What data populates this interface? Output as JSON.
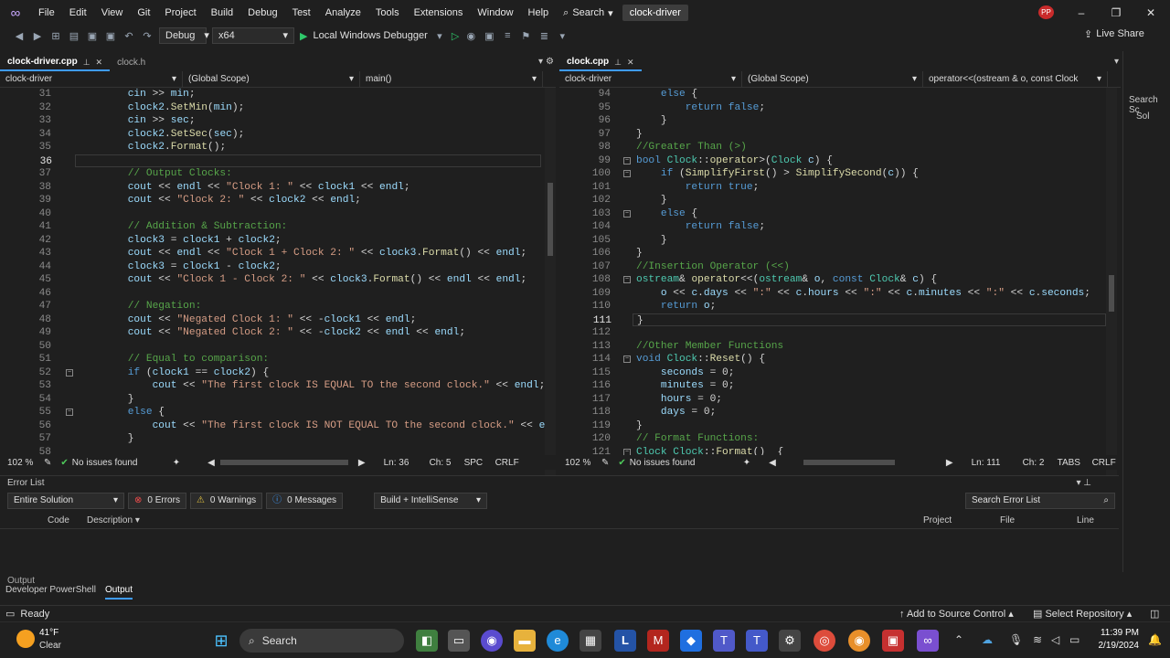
{
  "menu": {
    "items": [
      "File",
      "Edit",
      "View",
      "Git",
      "Project",
      "Build",
      "Debug",
      "Test",
      "Analyze",
      "Tools",
      "Extensions",
      "Window",
      "Help"
    ],
    "search_label": "Search",
    "project_name": "clock-driver",
    "avatar": "PP"
  },
  "toolbar": {
    "config": "Debug",
    "platform": "x64",
    "debugger": "Local Windows Debugger",
    "live_share": "Live Share"
  },
  "left_pane": {
    "tabs": [
      {
        "label": "clock-driver.cpp",
        "active": true
      },
      {
        "label": "clock.h",
        "active": false
      }
    ],
    "nav": [
      "clock-driver",
      "(Global Scope)",
      "main()"
    ],
    "lines": [
      {
        "n": "31",
        "t": "        cin >> min;"
      },
      {
        "n": "32",
        "t": "        clock2.SetMin(min);"
      },
      {
        "n": "33",
        "t": "        cin >> sec;"
      },
      {
        "n": "34",
        "t": "        clock2.SetSec(sec);"
      },
      {
        "n": "35",
        "t": "        clock2.Format();"
      },
      {
        "n": "36",
        "t": ""
      },
      {
        "n": "37",
        "t": "        // Output Clocks:"
      },
      {
        "n": "38",
        "t": "        cout << endl << \"Clock 1: \" << clock1 << endl;"
      },
      {
        "n": "39",
        "t": "        cout << \"Clock 2: \" << clock2 << endl;"
      },
      {
        "n": "40",
        "t": ""
      },
      {
        "n": "41",
        "t": "        // Addition & Subtraction:"
      },
      {
        "n": "42",
        "t": "        clock3 = clock1 + clock2;"
      },
      {
        "n": "43",
        "t": "        cout << endl << \"Clock 1 + Clock 2: \" << clock3.Format() << endl;"
      },
      {
        "n": "44",
        "t": "        clock3 = clock1 - clock2;"
      },
      {
        "n": "45",
        "t": "        cout << \"Clock 1 - Clock 2: \" << clock3.Format() << endl << endl;"
      },
      {
        "n": "46",
        "t": ""
      },
      {
        "n": "47",
        "t": "        // Negation:"
      },
      {
        "n": "48",
        "t": "        cout << \"Negated Clock 1: \" << -clock1 << endl;"
      },
      {
        "n": "49",
        "t": "        cout << \"Negated Clock 2: \" << -clock2 << endl << endl;"
      },
      {
        "n": "50",
        "t": ""
      },
      {
        "n": "51",
        "t": "        // Equal to comparison:"
      },
      {
        "n": "52",
        "t": "        if (clock1 == clock2) {"
      },
      {
        "n": "53",
        "t": "            cout << \"The first clock IS EQUAL TO the second clock.\" << endl;"
      },
      {
        "n": "54",
        "t": "        }"
      },
      {
        "n": "55",
        "t": "        else {"
      },
      {
        "n": "56",
        "t": "            cout << \"The first clock IS NOT EQUAL TO the second clock.\" << endl;"
      },
      {
        "n": "57",
        "t": "        }"
      },
      {
        "n": "58",
        "t": ""
      }
    ],
    "current_line": "36",
    "status": {
      "zoom": "102 %",
      "issues": "No issues found",
      "ln": "Ln: 36",
      "ch": "Ch: 5",
      "ws": "SPC",
      "eol": "CRLF"
    }
  },
  "right_pane": {
    "tabs": [
      {
        "label": "clock.cpp",
        "active": true
      }
    ],
    "nav": [
      "clock-driver",
      "(Global Scope)",
      "operator<<(ostream & o, const Clock"
    ],
    "lines": [
      {
        "n": "94",
        "t": "    else {"
      },
      {
        "n": "95",
        "t": "        return false;"
      },
      {
        "n": "96",
        "t": "    }"
      },
      {
        "n": "97",
        "t": "}"
      },
      {
        "n": "98",
        "t": "//Greater Than (>)"
      },
      {
        "n": "99",
        "t": "bool Clock::operator>(Clock c) {"
      },
      {
        "n": "100",
        "t": "    if (SimplifyFirst() > SimplifySecond(c)) {"
      },
      {
        "n": "101",
        "t": "        return true;"
      },
      {
        "n": "102",
        "t": "    }"
      },
      {
        "n": "103",
        "t": "    else {"
      },
      {
        "n": "104",
        "t": "        return false;"
      },
      {
        "n": "105",
        "t": "    }"
      },
      {
        "n": "106",
        "t": "}"
      },
      {
        "n": "107",
        "t": "//Insertion Operator (<<)"
      },
      {
        "n": "108",
        "t": "ostream& operator<<(ostream& o, const Clock& c) {"
      },
      {
        "n": "109",
        "t": "    o << c.days << \":\" << c.hours << \":\" << c.minutes << \":\" << c.seconds;"
      },
      {
        "n": "110",
        "t": "    return o;"
      },
      {
        "n": "111",
        "t": "}"
      },
      {
        "n": "112",
        "t": ""
      },
      {
        "n": "113",
        "t": "//Other Member Functions"
      },
      {
        "n": "114",
        "t": "void Clock::Reset() {"
      },
      {
        "n": "115",
        "t": "    seconds = 0;"
      },
      {
        "n": "116",
        "t": "    minutes = 0;"
      },
      {
        "n": "117",
        "t": "    hours = 0;"
      },
      {
        "n": "118",
        "t": "    days = 0;"
      },
      {
        "n": "119",
        "t": "}"
      },
      {
        "n": "120",
        "t": "// Format Functions:"
      },
      {
        "n": "121",
        "t": "Clock Clock::Format()  {"
      }
    ],
    "current_line": "111",
    "status": {
      "zoom": "102 %",
      "issues": "No issues found",
      "ln": "Ln: 111",
      "ch": "Ch: 2",
      "ws": "TABS",
      "eol": "CRLF"
    }
  },
  "error_list": {
    "title": "Error List",
    "scope": "Entire Solution",
    "errors": "0 Errors",
    "warnings": "0 Warnings",
    "messages": "0 Messages",
    "filter": "Build + IntelliSense",
    "search_placeholder": "Search Error List",
    "columns": [
      "Code",
      "Description",
      "Project",
      "File",
      "Line"
    ]
  },
  "output": {
    "title": "Output",
    "tabs": [
      "Developer PowerShell",
      "Output"
    ]
  },
  "right_strip": {
    "search": "Search Sc",
    "item": "Sol"
  },
  "statusbar": {
    "state": "Ready",
    "source_control": "Add to Source Control",
    "repository": "Select Repository"
  },
  "taskbar": {
    "weather_temp": "41°F",
    "weather_desc": "Clear",
    "search": "Search",
    "time": "11:39 PM",
    "date": "2/19/2024"
  }
}
